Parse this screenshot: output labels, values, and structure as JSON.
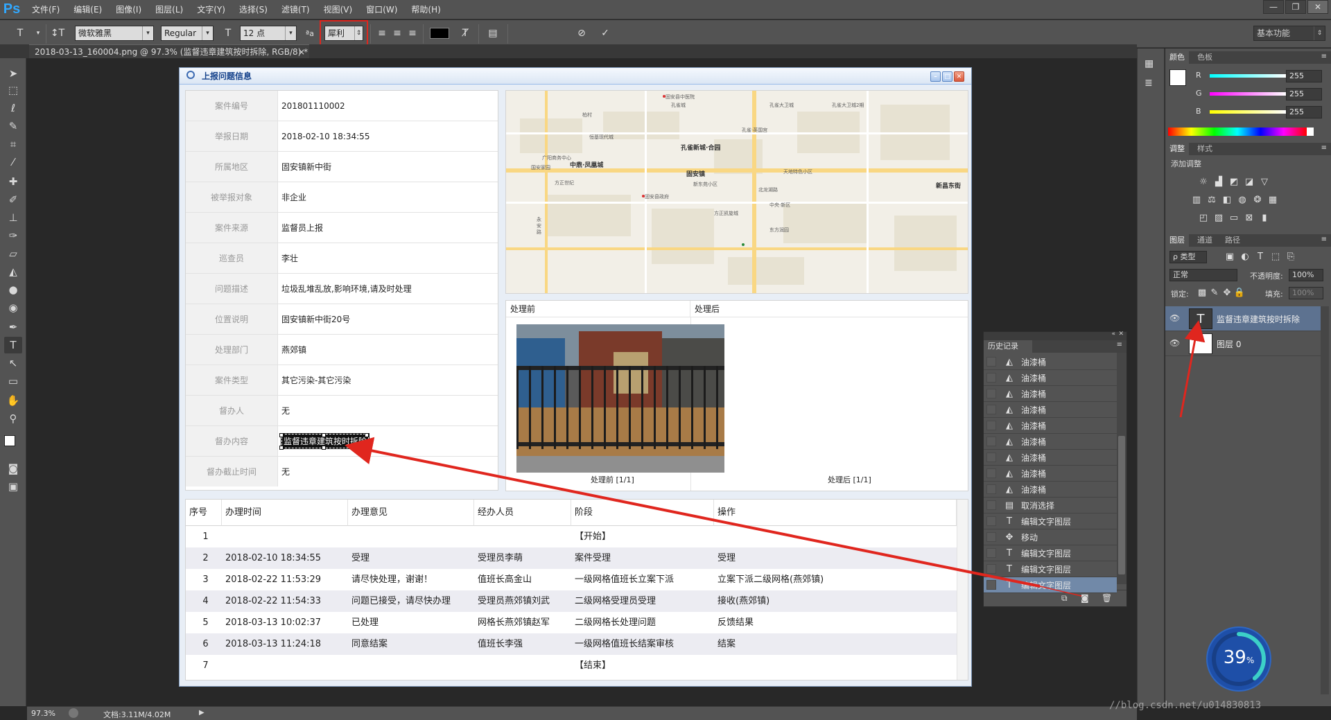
{
  "app": {
    "logo": "Ps",
    "menu": [
      "文件(F)",
      "编辑(E)",
      "图像(I)",
      "图层(L)",
      "文字(Y)",
      "选择(S)",
      "滤镜(T)",
      "视图(V)",
      "窗口(W)",
      "帮助(H)"
    ],
    "window_controls": [
      "—",
      "❐",
      "✕"
    ]
  },
  "options": {
    "font_family": "微软雅黑",
    "font_style": "Regular",
    "font_size": "12 点",
    "aa_icon_text": "ªa",
    "antialias": "犀利",
    "workspace": "基本功能"
  },
  "document": {
    "tab_title": "2018-03-13_160004.png @ 97.3% (监督违章建筑按时拆除, RGB/8) *",
    "tab_close": "×"
  },
  "panel": {
    "title": "上报问题信息",
    "fields": [
      {
        "label": "案件编号",
        "value": "201801110002"
      },
      {
        "label": "举报日期",
        "value": "2018-02-10 18:34:55"
      },
      {
        "label": "所属地区",
        "value": "固安镇新中街"
      },
      {
        "label": "被举报对象",
        "value": "非企业"
      },
      {
        "label": "案件来源",
        "value": "监督员上报"
      },
      {
        "label": "巡查员",
        "value": "李壮"
      },
      {
        "label": "问题描述",
        "value": "垃圾乱堆乱放,影响环境,请及时处理"
      },
      {
        "label": "位置说明",
        "value": "固安镇新中街20号"
      },
      {
        "label": "处理部门",
        "value": "燕郊镇"
      },
      {
        "label": "案件类型",
        "value": "其它污染-其它污染"
      },
      {
        "label": "督办人",
        "value": "无"
      },
      {
        "label": "督办内容",
        "value": "监督违章建筑按时拆除"
      },
      {
        "label": "督办截止时间",
        "value": "无"
      }
    ],
    "before_label": "处理前",
    "after_label": "处理后",
    "before_caption": "处理前 [1/1]",
    "after_caption": "处理后 [1/1]",
    "table": {
      "headers": [
        "序号",
        "办理时间",
        "办理意见",
        "经办人员",
        "阶段",
        "操作"
      ],
      "rows": [
        [
          "1",
          "",
          "",
          "",
          "【开始】",
          ""
        ],
        [
          "2",
          "2018-02-10 18:34:55",
          "受理",
          "受理员李萌",
          "案件受理",
          "受理"
        ],
        [
          "3",
          "2018-02-22 11:53:29",
          "请尽快处理，谢谢！",
          "值班长高金山",
          "一级网格值班长立案下派",
          "立案下派二级网格(燕郊镇)"
        ],
        [
          "4",
          "2018-02-22 11:54:33",
          "问题已接受，请尽快办理",
          "受理员燕郊镇刘武",
          "二级网格受理员受理",
          "接收(燕郊镇)"
        ],
        [
          "5",
          "2018-03-13 10:02:37",
          "已处理",
          "网格长燕郊镇赵军",
          "二级网格长处理问题",
          "反馈结果"
        ],
        [
          "6",
          "2018-03-13 11:24:18",
          "同意结案",
          "值班长李强",
          "一级网格值班长结案审核",
          "结案"
        ],
        [
          "7",
          "",
          "",
          "",
          "【结束】",
          ""
        ]
      ]
    }
  },
  "map": {
    "labels": [
      "固安县中医院",
      "柏村",
      "孔雀城",
      "孔雀新城·合园",
      "中鼎·凤凰城",
      "固安镇",
      "新昌东街",
      "固安县政府",
      "广阳商务中心",
      "天地特色小区",
      "孔雀大卫城",
      "孔雀大卫城2期",
      "方正世纪",
      "北龙湖路",
      "孔雀·英国宫",
      "恒基现代城",
      "国安家园",
      "新东苑小区",
      "方正凯旋城",
      "中央·新区",
      "东方润园"
    ],
    "road_label": "永安路"
  },
  "history": {
    "title": "历史记录",
    "items": [
      {
        "icon": "paint-bucket",
        "glyph": "◭",
        "label": "油漆桶"
      },
      {
        "icon": "paint-bucket",
        "glyph": "◭",
        "label": "油漆桶"
      },
      {
        "icon": "paint-bucket",
        "glyph": "◭",
        "label": "油漆桶"
      },
      {
        "icon": "paint-bucket",
        "glyph": "◭",
        "label": "油漆桶"
      },
      {
        "icon": "paint-bucket",
        "glyph": "◭",
        "label": "油漆桶"
      },
      {
        "icon": "paint-bucket",
        "glyph": "◭",
        "label": "油漆桶"
      },
      {
        "icon": "paint-bucket",
        "glyph": "◭",
        "label": "油漆桶"
      },
      {
        "icon": "paint-bucket",
        "glyph": "◭",
        "label": "油漆桶"
      },
      {
        "icon": "paint-bucket",
        "glyph": "◭",
        "label": "油漆桶"
      },
      {
        "icon": "deselect",
        "glyph": "▤",
        "label": "取消选择"
      },
      {
        "icon": "type",
        "glyph": "T",
        "label": "编辑文字图层"
      },
      {
        "icon": "move",
        "glyph": "✥",
        "label": "移动"
      },
      {
        "icon": "type",
        "glyph": "T",
        "label": "编辑文字图层"
      },
      {
        "icon": "type",
        "glyph": "T",
        "label": "编辑文字图层"
      },
      {
        "icon": "type",
        "glyph": "T",
        "label": "编辑文字图层"
      }
    ],
    "selected_index": 14
  },
  "panels": {
    "color_tabs": [
      "颜色",
      "色板"
    ],
    "rgb": [
      {
        "ch": "R",
        "value": "255"
      },
      {
        "ch": "G",
        "value": "255"
      },
      {
        "ch": "B",
        "value": "255"
      }
    ],
    "adjust_tabs": [
      "调整",
      "样式"
    ],
    "adjust_add": "添加调整",
    "layers_tabs": [
      "图层",
      "通道",
      "路径"
    ],
    "filter_kind": "ρ 类型",
    "blend_mode": "正常",
    "opacity_label": "不透明度:",
    "opacity_value": "100%",
    "lock_label": "锁定:",
    "fill_label": "填充:",
    "fill_value": "100%",
    "layers": [
      {
        "name": "监督违章建筑按时拆除",
        "thumb": "T",
        "selected": true
      },
      {
        "name": "图层 0",
        "thumb": "",
        "selected": false
      }
    ]
  },
  "status": {
    "zoom": "97.3%",
    "doc_size": "文档:3.11M/4.02M",
    "watermark": "//blog.csdn.net/u014830813",
    "perf_value": "39",
    "perf_unit": "%"
  },
  "colors": {
    "annotation": "#e0261e",
    "ps_blue": "#31a8ff",
    "selection": "#7189a8"
  }
}
